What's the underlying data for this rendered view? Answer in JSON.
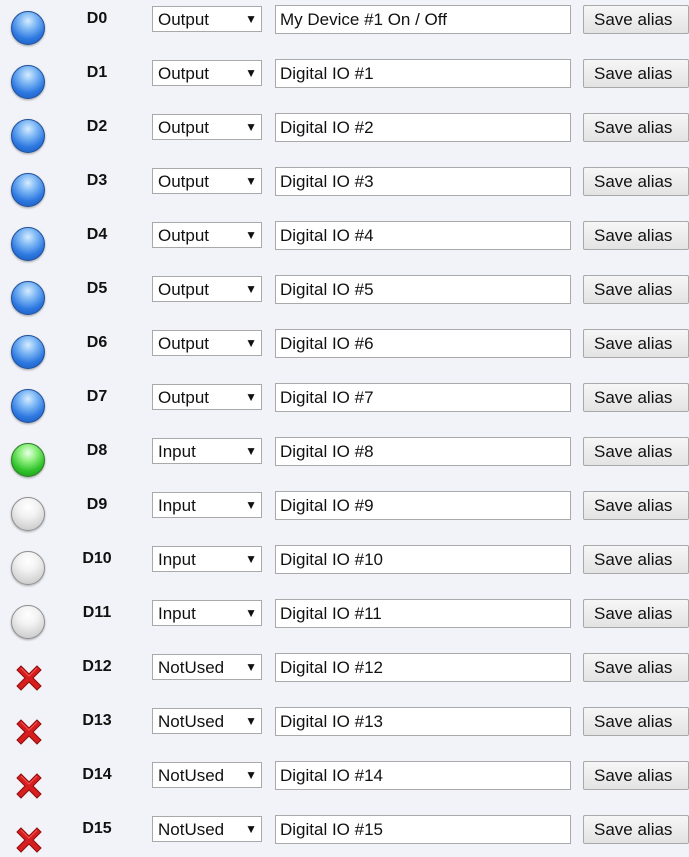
{
  "rows": [
    {
      "pin": "D0",
      "status": "on-blue",
      "mode": "Output",
      "alias": "My Device #1 On / Off"
    },
    {
      "pin": "D1",
      "status": "on-blue",
      "mode": "Output",
      "alias": "Digital IO #1"
    },
    {
      "pin": "D2",
      "status": "on-blue",
      "mode": "Output",
      "alias": "Digital IO #2"
    },
    {
      "pin": "D3",
      "status": "on-blue",
      "mode": "Output",
      "alias": "Digital IO #3"
    },
    {
      "pin": "D4",
      "status": "on-blue",
      "mode": "Output",
      "alias": "Digital IO #4"
    },
    {
      "pin": "D5",
      "status": "on-blue",
      "mode": "Output",
      "alias": "Digital IO #5"
    },
    {
      "pin": "D6",
      "status": "on-blue",
      "mode": "Output",
      "alias": "Digital IO #6"
    },
    {
      "pin": "D7",
      "status": "on-blue",
      "mode": "Output",
      "alias": "Digital IO #7"
    },
    {
      "pin": "D8",
      "status": "on-green",
      "mode": "Input",
      "alias": "Digital IO #8"
    },
    {
      "pin": "D9",
      "status": "off",
      "mode": "Input",
      "alias": "Digital IO #9"
    },
    {
      "pin": "D10",
      "status": "off",
      "mode": "Input",
      "alias": "Digital IO #10"
    },
    {
      "pin": "D11",
      "status": "off",
      "mode": "Input",
      "alias": "Digital IO #11"
    },
    {
      "pin": "D12",
      "status": "not-used",
      "mode": "NotUsed",
      "alias": "Digital IO #12"
    },
    {
      "pin": "D13",
      "status": "not-used",
      "mode": "NotUsed",
      "alias": "Digital IO #13"
    },
    {
      "pin": "D14",
      "status": "not-used",
      "mode": "NotUsed",
      "alias": "Digital IO #14"
    },
    {
      "pin": "D15",
      "status": "not-used",
      "mode": "NotUsed",
      "alias": "Digital IO #15"
    }
  ],
  "save_button_label": "Save alias",
  "dropdown_arrow": "▼",
  "icons": {
    "on-blue": "blue-led-icon",
    "on-green": "green-led-icon",
    "off": "grey-led-icon",
    "not-used": "red-x-icon"
  },
  "colors": {
    "background": "#f2f3f8",
    "led_blue": "#2d78e0",
    "led_green": "#2fc22a",
    "led_off": "#d3d3d3",
    "x_red": "#d71e1e"
  }
}
